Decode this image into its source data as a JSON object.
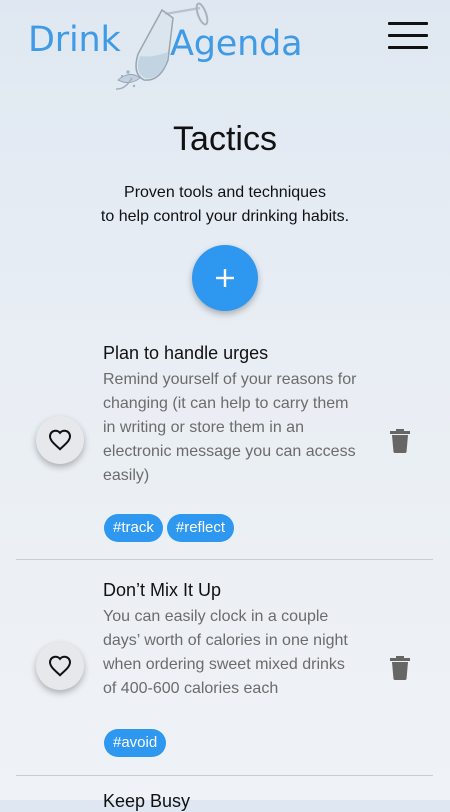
{
  "header": {
    "logo_word_1": "Drink",
    "logo_word_2": "Agenda"
  },
  "page": {
    "title": "Tactics",
    "subtitle_line1": "Proven tools and techniques",
    "subtitle_line2": "to help control your drinking habits.",
    "add_label": "+"
  },
  "tactics": [
    {
      "title": "Plan to handle urges",
      "description_lines": [
        "Remind yourself of your reasons for",
        "changing (it can help to carry them",
        "in writing or store them in an",
        "electronic message you can access",
        "easily)"
      ],
      "tags": [
        "#track",
        "#reflect"
      ]
    },
    {
      "title": "Don’t Mix It Up",
      "description_lines": [
        "You can easily clock in a couple",
        "days’ worth of calories in one night",
        "when ordering sweet mixed drinks",
        "of 400-600 calories each"
      ],
      "tags": [
        "#avoid"
      ]
    },
    {
      "title": "Keep Busy"
    }
  ],
  "colors": {
    "accent": "#2e97f0",
    "logo": "#3f9be6",
    "description_text": "#6b6b6b"
  },
  "icons": {
    "menu": "hamburger-icon",
    "add": "plus-icon",
    "favorite": "heart-outline-icon",
    "delete": "trash-icon"
  }
}
